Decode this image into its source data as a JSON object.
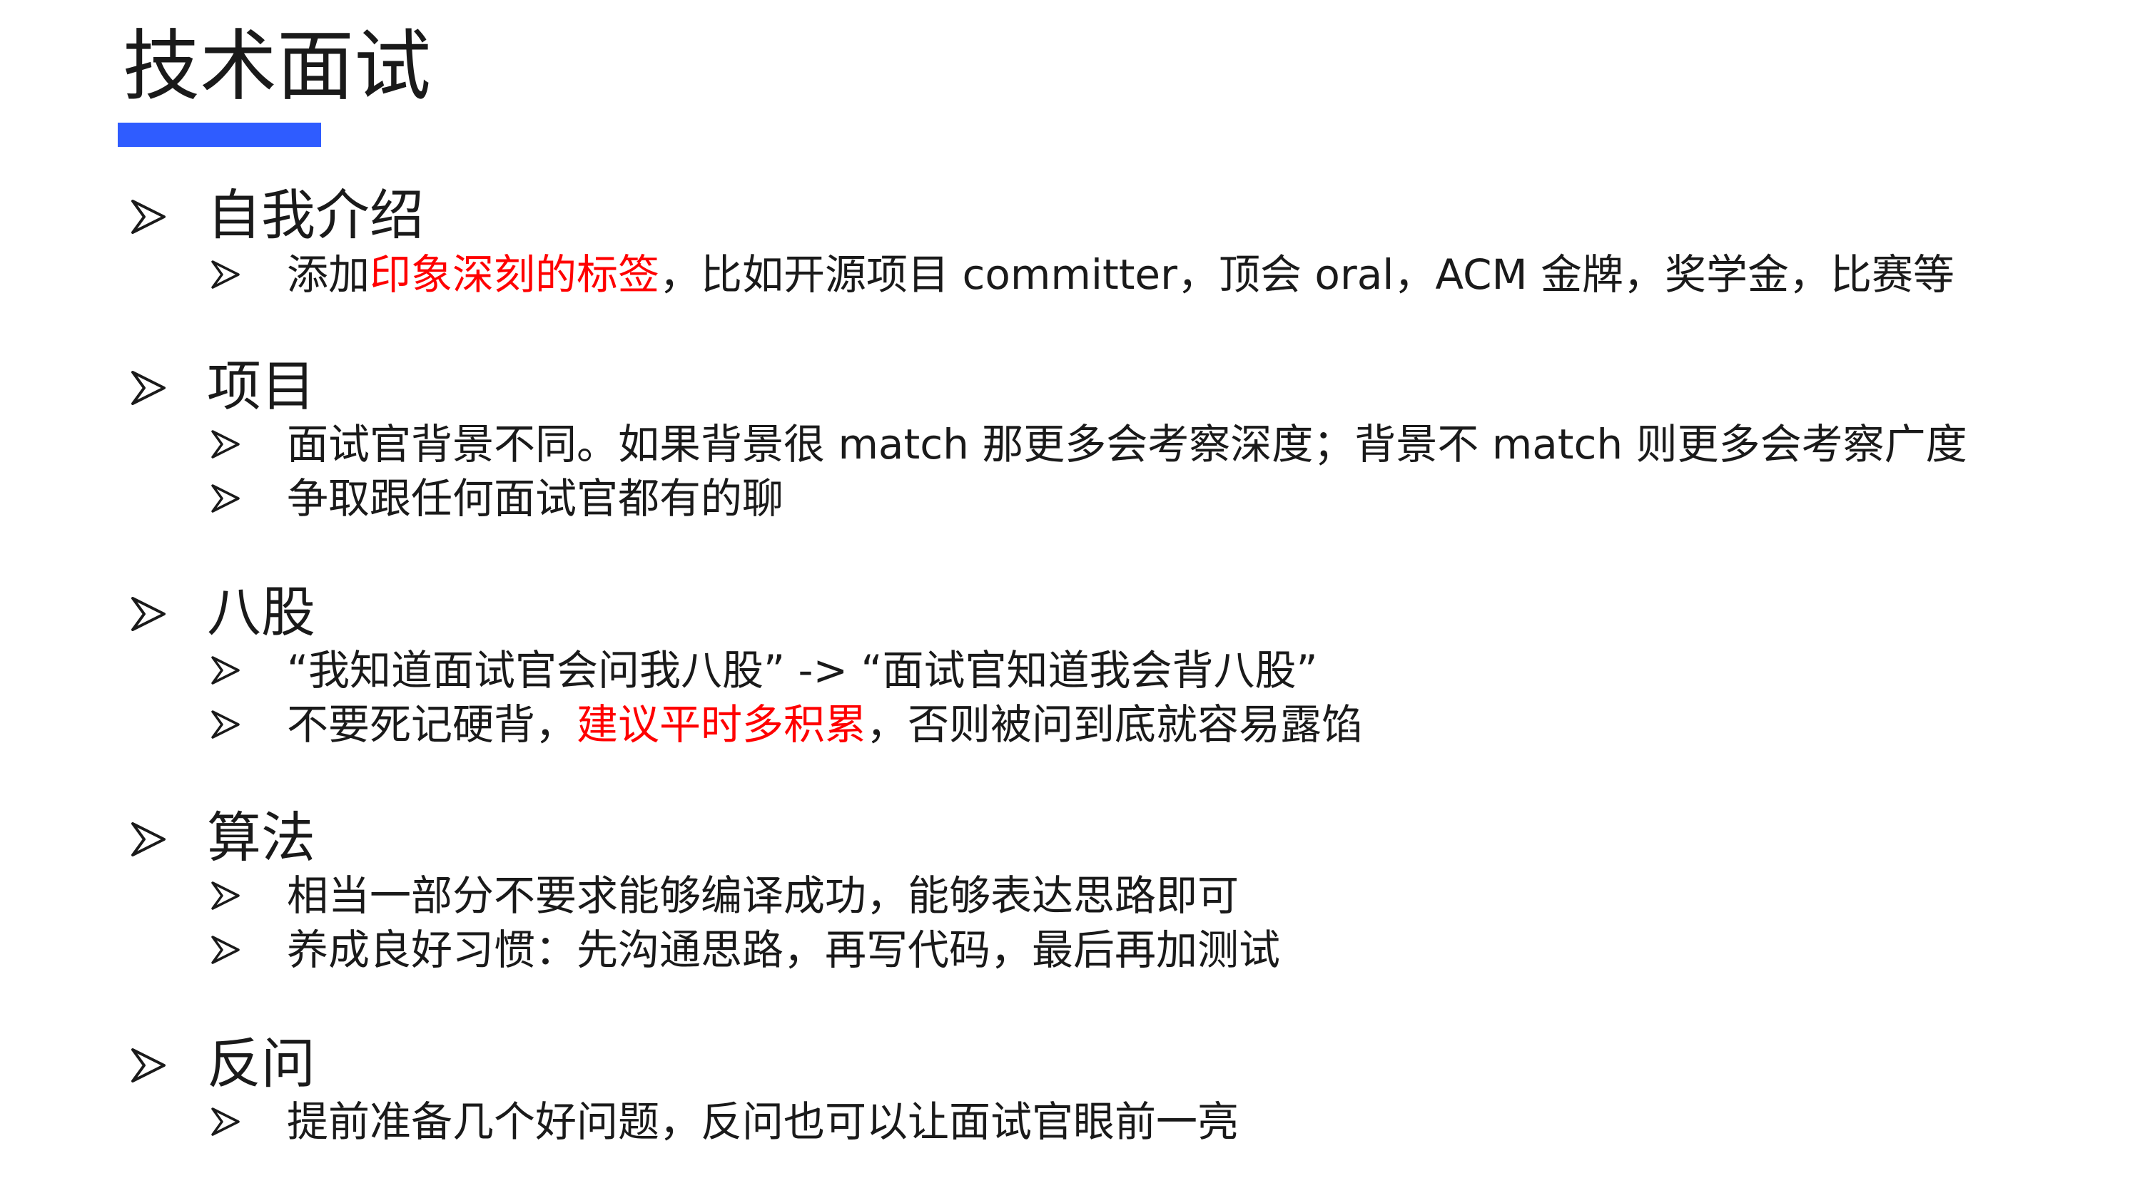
{
  "slide": {
    "title": "技术面试",
    "accent_color": "#2f5cff",
    "highlight_color": "#ff0000",
    "bullet_icon": "arrowhead-bullet-icon"
  },
  "sections": [
    {
      "label": "自我介绍",
      "items": [
        {
          "pre": "添加",
          "highlight": "印象深刻的标签",
          "post": "，比如开源项目 committer，顶会 oral，ACM 金牌，奖学金，比赛等"
        }
      ]
    },
    {
      "label": "项目",
      "items": [
        {
          "text": "面试官背景不同。如果背景很 match 那更多会考察深度；背景不 match 则更多会考察广度"
        },
        {
          "text": "争取跟任何面试官都有的聊"
        }
      ]
    },
    {
      "label": "八股",
      "items": [
        {
          "text": " “我知道面试官会问我八股” ->  “面试官知道我会背八股”"
        },
        {
          "pre": "不要死记硬背，",
          "highlight": "建议平时多积累",
          "post": "，否则被问到底就容易露馅"
        }
      ]
    },
    {
      "label": "算法",
      "items": [
        {
          "text": "相当一部分不要求能够编译成功，能够表达思路即可"
        },
        {
          "text": "养成良好习惯：先沟通思路，再写代码，最后再加测试"
        }
      ]
    },
    {
      "label": "反问",
      "items": [
        {
          "text": "提前准备几个好问题，反问也可以让面试官眼前一亮"
        }
      ]
    }
  ]
}
